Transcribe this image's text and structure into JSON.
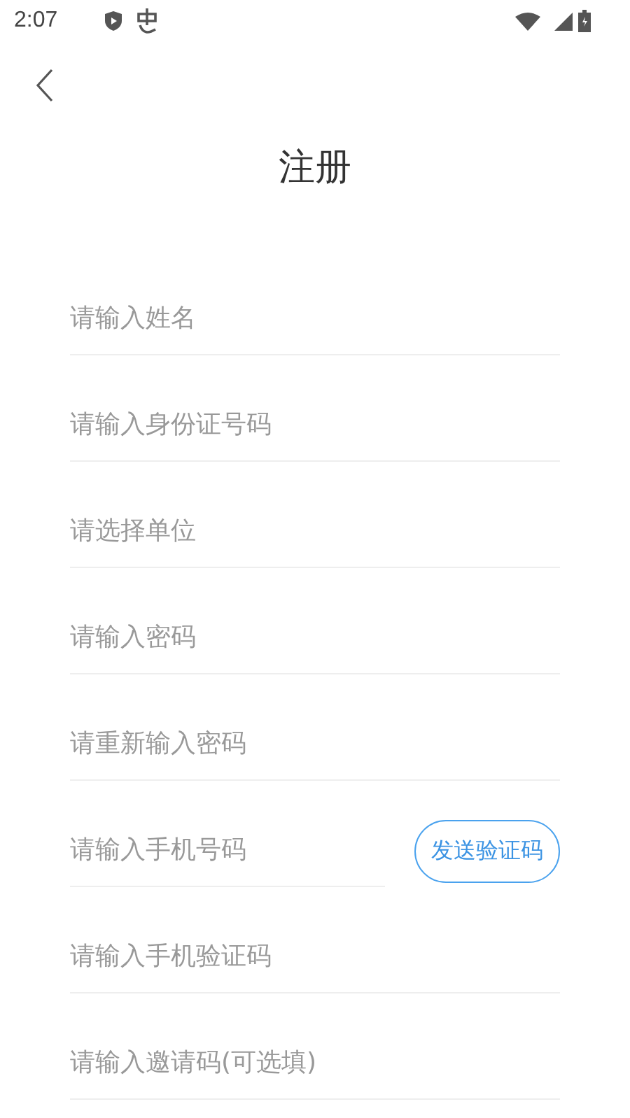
{
  "status_bar": {
    "time": "2:07"
  },
  "title": "注册",
  "fields": [
    {
      "kind": "plain",
      "placeholder": "请输入姓名"
    },
    {
      "kind": "plain",
      "placeholder": "请输入身份证号码"
    },
    {
      "kind": "plain",
      "placeholder": "请选择单位"
    },
    {
      "kind": "plain",
      "placeholder": "请输入密码"
    },
    {
      "kind": "plain",
      "placeholder": "请重新输入密码"
    },
    {
      "kind": "with_button",
      "placeholder": "请输入手机号码",
      "button": "发送验证码"
    },
    {
      "kind": "plain",
      "placeholder": "请输入手机验证码"
    },
    {
      "kind": "plain",
      "placeholder": "请输入邀请码(可选填)"
    }
  ]
}
